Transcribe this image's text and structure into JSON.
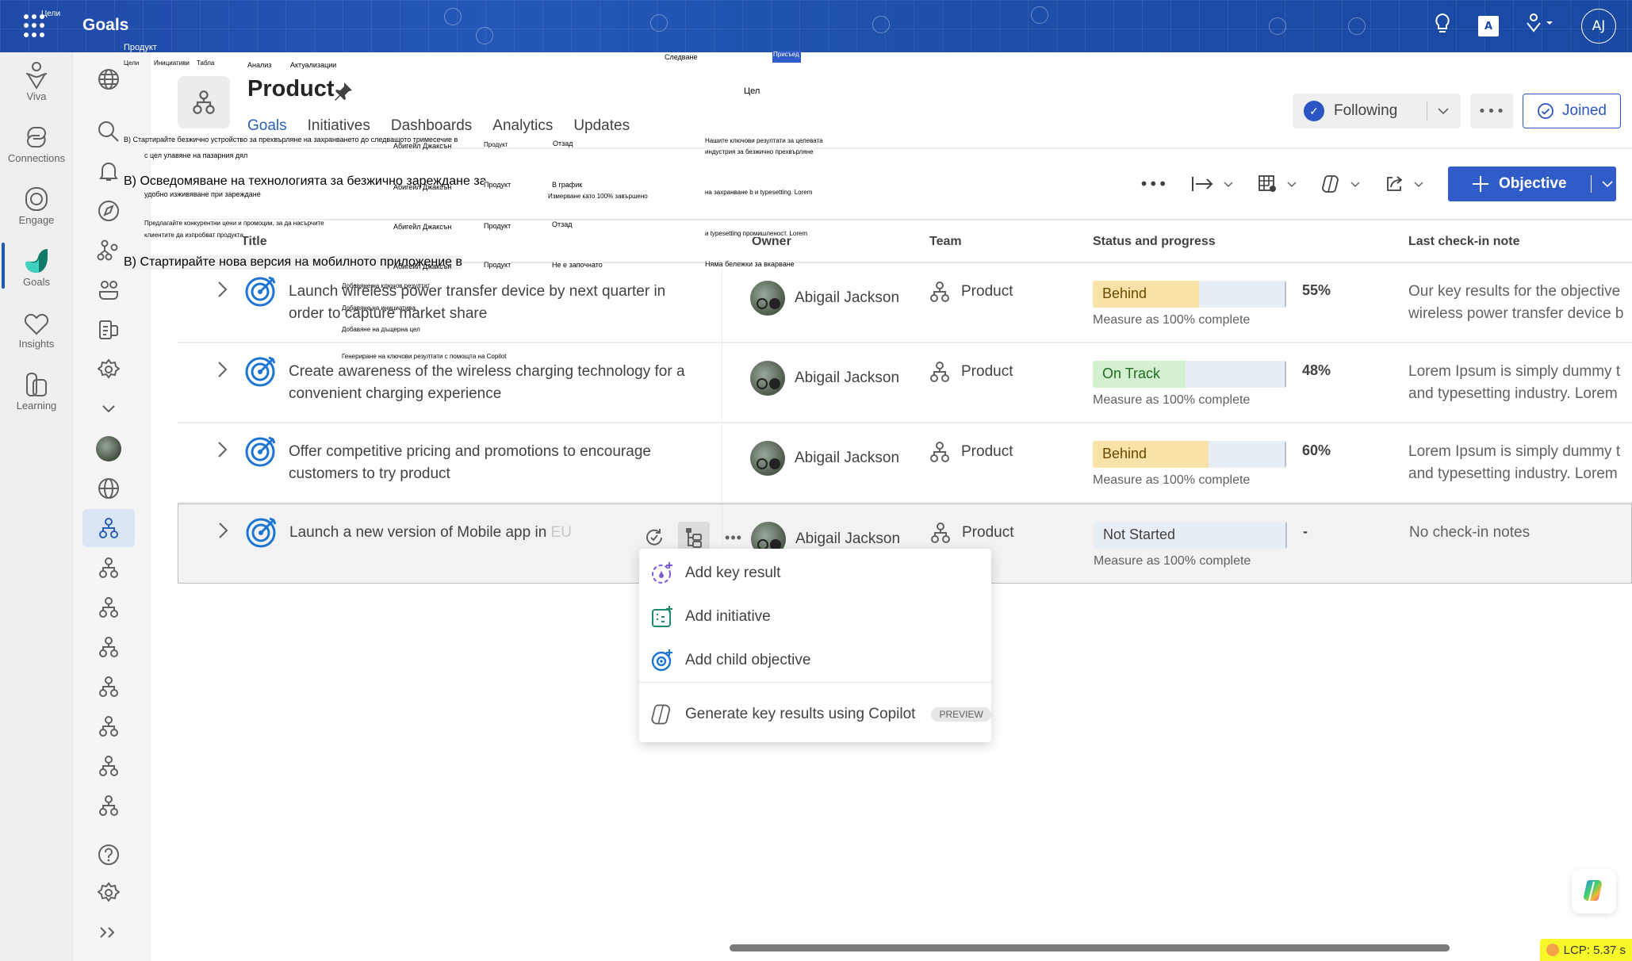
{
  "app": {
    "title": "Goals",
    "top_icons": [
      "lightbulb-icon",
      "office-admin-icon",
      "viva-switcher-icon"
    ],
    "user_initials": "AJ"
  },
  "rail": {
    "items": [
      {
        "label": "Viva",
        "icon": "viva-icon"
      },
      {
        "label": "Connections",
        "icon": "connections-icon"
      },
      {
        "label": "Engage",
        "icon": "engage-icon"
      },
      {
        "label": "Goals",
        "icon": "goals-icon",
        "active": true
      },
      {
        "label": "Insights",
        "icon": "insights-icon"
      },
      {
        "label": "Learning",
        "icon": "learning-icon"
      }
    ]
  },
  "nav": {
    "top_icons": [
      "globe-icon",
      "search-icon",
      "bell-icon",
      "compass-icon",
      "org-chart-icon",
      "people-icon",
      "reports-icon",
      "settings-icon",
      "chevron-down-icon"
    ],
    "team_icons": [
      "user-avatar",
      "globe-icon",
      "team-icon",
      "team-icon",
      "team-icon",
      "team-icon",
      "team-icon",
      "team-icon",
      "team-icon",
      "team-icon"
    ],
    "bottom_icons": [
      "help-icon",
      "settings-icon",
      "expand-icon"
    ]
  },
  "header": {
    "title": "Product",
    "tabs": [
      "Goals",
      "Initiatives",
      "Dashboards",
      "Analytics",
      "Updates"
    ],
    "active_tab": "Goals",
    "following_label": "Following",
    "joined_label": "Joined",
    "more_label": "•••"
  },
  "toolbar": {
    "more_label": "•••",
    "objective_label": "Objective"
  },
  "table": {
    "columns": [
      "Title",
      "Owner",
      "Team",
      "Status and progress",
      "Last check-in note"
    ],
    "rows": [
      {
        "title": "Launch wireless power transfer device by next quarter in order to capture market share",
        "title_line1": "Launch wireless power transfer device by next quarter in",
        "title_line2": "order to capture market share",
        "owner": "Abigail Jackson",
        "team": "Product",
        "status": "Behind",
        "progress": 55,
        "progress_label": "55%",
        "measure": "Measure as 100% complete",
        "note_line1": "Our key results for the objective",
        "note_line2": "wireless power transfer device b"
      },
      {
        "title": "Create awareness of the wireless charging technology for a convenient charging experience",
        "title_line1": "Create awareness of the wireless charging technology for a",
        "title_line2": "convenient charging experience",
        "owner": "Abigail Jackson",
        "team": "Product",
        "status": "On Track",
        "progress": 48,
        "progress_label": "48%",
        "measure": "Measure as 100% complete",
        "note_line1": "Lorem Ipsum is simply dummy t",
        "note_line2": "and typesetting industry. Lorem"
      },
      {
        "title": "Offer competitive pricing and promotions to encourage customers to try product",
        "title_line1": "Offer competitive pricing and promotions to encourage",
        "title_line2": "customers to try product",
        "owner": "Abigail Jackson",
        "team": "Product",
        "status": "Behind",
        "progress": 60,
        "progress_label": "60%",
        "measure": "Measure as 100% complete",
        "note_line1": "Lorem Ipsum is simply dummy t",
        "note_line2": "and typesetting industry. Lorem"
      },
      {
        "title": "Launch a new version of Mobile app in EU market",
        "title_line1": "Launch a new version of Mobile app in",
        "title_faded": "EU r",
        "owner": "Abigail Jackson",
        "team": "Product",
        "status": "Not Started",
        "progress": 0,
        "progress_label": "-",
        "measure": "Measure as 100% complete",
        "note_line1": "No check-in notes"
      }
    ]
  },
  "status_colors": {
    "Behind": {
      "fill": "#f9e2a8",
      "text": "#6b4a00"
    },
    "On Track": {
      "fill": "#d3f0d0",
      "text": "#1f6b1f"
    },
    "Not Started": {
      "fill": "#e8eef5",
      "text": "#424242"
    }
  },
  "context_menu": {
    "items": [
      {
        "label": "Add key result",
        "icon": "add-key-result-icon",
        "color": "#7a5ad6"
      },
      {
        "label": "Add initiative",
        "icon": "add-initiative-icon",
        "color": "#1f8a6e"
      },
      {
        "label": "Add child objective",
        "icon": "add-child-objective-icon",
        "color": "#1c75d2"
      },
      {
        "label": "Generate key results using Copilot",
        "icon": "copilot-icon",
        "badge": "PREVIEW"
      }
    ]
  },
  "lcp": {
    "label": "LCP: 5.37 s"
  },
  "translation_overlay": {
    "app": "Цели",
    "team": "Продукт",
    "tabs": [
      "Цели",
      "Инициативи",
      "Табла",
      "Анализ",
      "Актуализации"
    ],
    "following": "Следване",
    "joined": "Присъед",
    "objective": "Цел",
    "row1_title_a": "В) Стартирайте безжично устройство за прехвърляне на захранването до следващото тримесечие в",
    "row1_title_b": "с цел улавяне на пазарния дял",
    "row1_owner": "Абигейл Джаксън",
    "row1_team": "Продукт",
    "row1_status": "Отзад",
    "row1_note_a": "Нашите ключови резултати за целевата",
    "row1_note_b": "индустрия за безжично прехвърляне",
    "row2_title_a": "В) Осведомяване на технологията за безжично зареждане за",
    "row2_title_b": "удобно изживяване при зареждане",
    "row2_owner": "Абигейл Джаксън",
    "row2_team": "Продукт",
    "row2_status": "В график",
    "row2_measure": "Измерване като 100% завършено",
    "row2_note": "на захранване b и typesetting. Lorem",
    "row3_title_a": "Предлагайте конкурентни цени и промоции, за да насърчите",
    "row3_title_b": "клиентите да изпробват продукта",
    "row3_owner": "Абигейл Джаксън",
    "row3_team": "Продукт",
    "row3_status": "Отзад",
    "row3_note": "и typesetting промишленост. Lorem",
    "row4_title": "В) Стартирайте нова версия на мобилното приложение в",
    "row4_owner": "Абигейл Джаксън",
    "row4_team": "Продукт",
    "row4_status": "Не е започнато",
    "row4_note": "Няма бележки за вкарване",
    "menu_1": "Добавяне на ключов резултат",
    "menu_2": "Добавяне на инициатива",
    "menu_3": "Добавяне на дъщерна цел",
    "menu_4": "Генериране на ключови резултати с помощта на Copilot"
  }
}
